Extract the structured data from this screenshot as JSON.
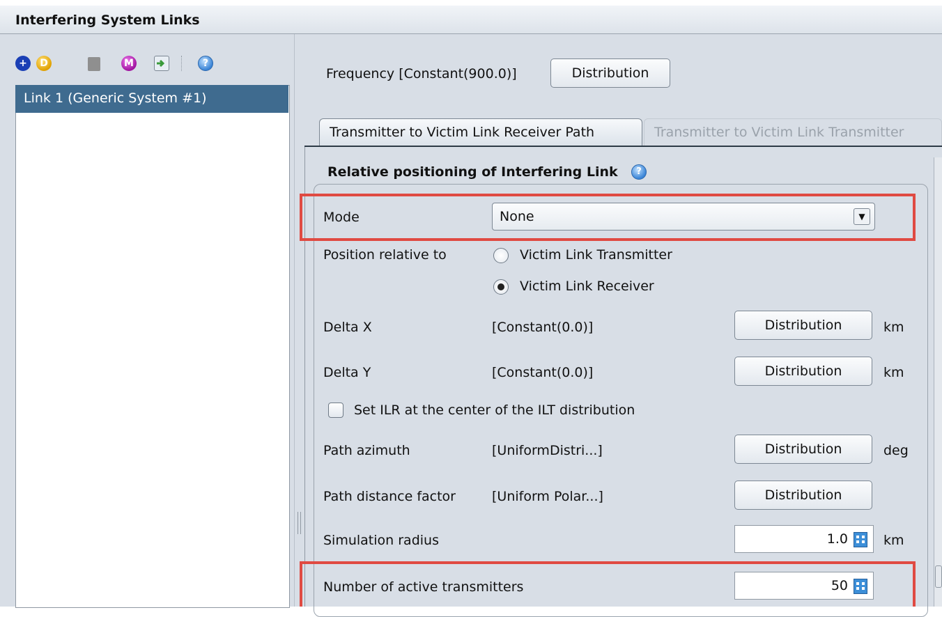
{
  "window": {
    "title": "Interfering System Links"
  },
  "toolbar": {
    "buttons": [
      {
        "icon": "add-icon",
        "glyph": "+",
        "color": "#1a3fb5"
      },
      {
        "icon": "duplicate-icon",
        "glyph": "D",
        "color": "#e0a000"
      },
      {
        "icon": "delete-icon",
        "glyph": "",
        "color": "#8f8f8f"
      },
      {
        "icon": "manage-icon",
        "glyph": "M",
        "color": "#a0139f"
      },
      {
        "icon": "import-icon",
        "glyph": "",
        "color": "#3a9a3a"
      },
      {
        "icon": "help-icon",
        "glyph": "?",
        "color": "#3a84d6"
      }
    ]
  },
  "links": {
    "items": [
      {
        "label": "Link 1 (Generic System #1)",
        "selected": true
      }
    ]
  },
  "frequency": {
    "label": "Frequency [Constant(900.0)]",
    "button": "Distribution"
  },
  "tabs": [
    {
      "label": "Transmitter to Victim Link Receiver Path",
      "active": true
    },
    {
      "label": "Transmitter to Victim Link Transmitter",
      "active": false
    }
  ],
  "section": {
    "title": "Relative positioning of Interfering Link",
    "help_glyph": "?"
  },
  "mode": {
    "label": "Mode",
    "value": "None",
    "arrow": "▼"
  },
  "position": {
    "label": "Position relative to",
    "options": [
      {
        "label": "Victim Link Transmitter",
        "checked": false
      },
      {
        "label": "Victim Link Receiver",
        "checked": true
      }
    ]
  },
  "rows": {
    "delta_x": {
      "label": "Delta X",
      "value": "[Constant(0.0)]",
      "button": "Distribution",
      "unit": "km"
    },
    "delta_y": {
      "label": "Delta Y",
      "value": "[Constant(0.0)]",
      "button": "Distribution",
      "unit": "km"
    },
    "ilr_center": {
      "label": "Set ILR at the center of the ILT distribution",
      "checked": false
    },
    "path_azimuth": {
      "label": "Path azimuth",
      "value": "[UniformDistri...]",
      "button": "Distribution",
      "unit": "deg"
    },
    "path_distance": {
      "label": "Path distance factor",
      "value": "[Uniform Polar...]",
      "button": "Distribution",
      "unit": ""
    },
    "sim_radius": {
      "label": "Simulation radius",
      "value": "1.0",
      "unit": "km"
    },
    "active_tx": {
      "label": "Number of active transmitters",
      "value": "50"
    }
  },
  "colors": {
    "highlight": "#e04a42",
    "selection": "#3f6b8f",
    "panel_bg": "#d8dee6"
  }
}
